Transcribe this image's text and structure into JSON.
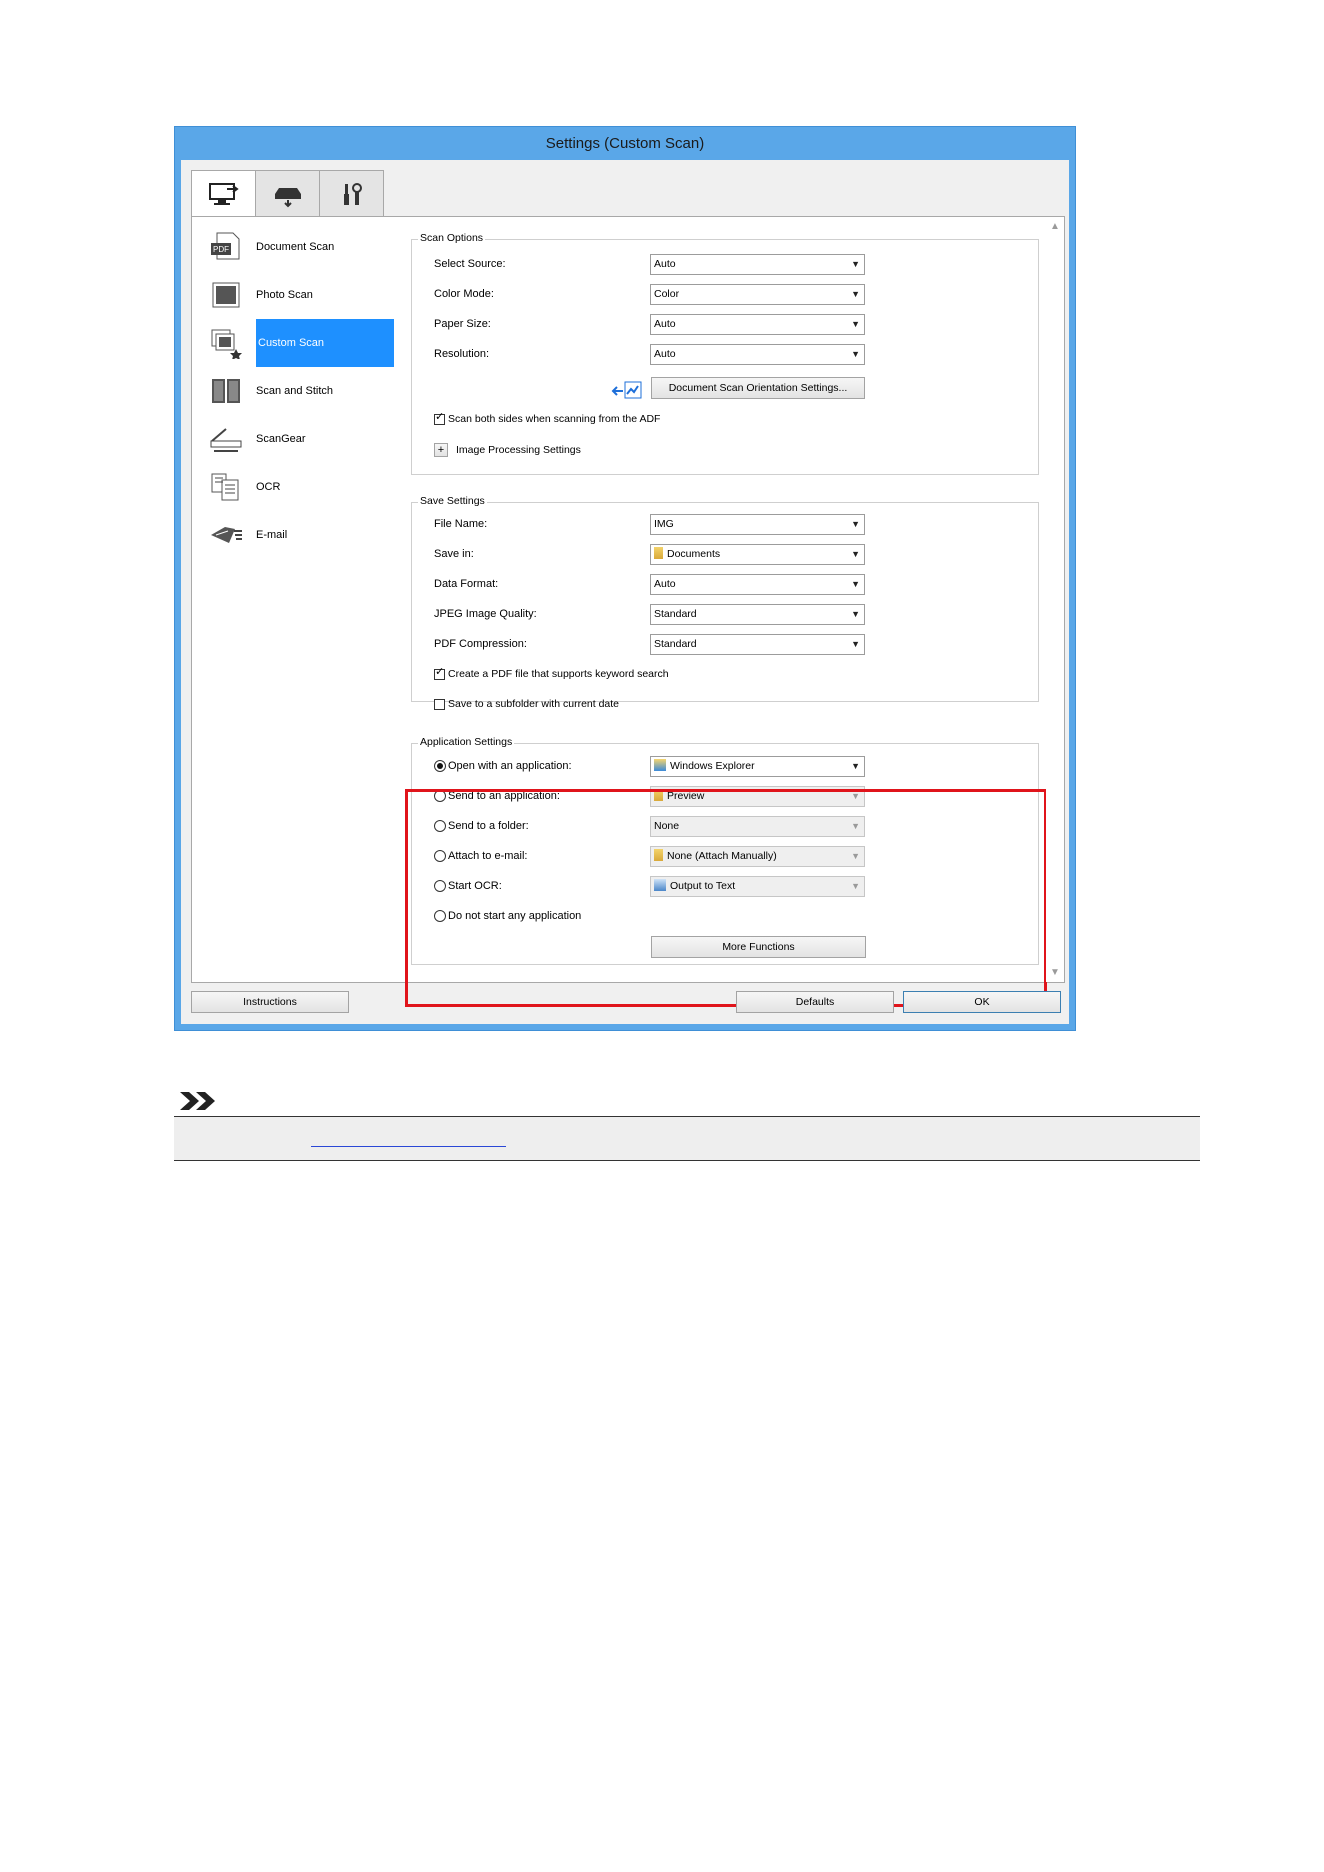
{
  "window": {
    "title": "Settings (Custom Scan)",
    "tabs": [
      {
        "icon": "computer-scan-icon"
      },
      {
        "icon": "scanner-icon"
      },
      {
        "icon": "general-settings-icon"
      }
    ]
  },
  "modes": [
    {
      "label": "Document Scan",
      "icon": "pdf-document-icon"
    },
    {
      "label": "Photo Scan",
      "icon": "photo-icon"
    },
    {
      "label": "Custom Scan",
      "icon": "custom-scan-icon",
      "selected": true
    },
    {
      "label": "Scan and Stitch",
      "icon": "stitch-icon"
    },
    {
      "label": "ScanGear",
      "icon": "scangear-icon"
    },
    {
      "label": "OCR",
      "icon": "ocr-icon"
    },
    {
      "label": "E-mail",
      "icon": "email-icon"
    }
  ],
  "scan_options": {
    "title": "Scan Options",
    "rows": [
      {
        "label": "Select Source:",
        "value": "Auto"
      },
      {
        "label": "Color Mode:",
        "value": "Color"
      },
      {
        "label": "Paper Size:",
        "value": "Auto"
      },
      {
        "label": "Resolution:",
        "value": "Auto"
      }
    ],
    "orientation_button": "Document Scan Orientation Settings...",
    "scan_both_sides": {
      "label": "Scan both sides when scanning from the ADF",
      "checked": true
    },
    "image_processing": {
      "expander": "+",
      "label": "Image Processing Settings"
    }
  },
  "save_settings": {
    "title": "Save Settings",
    "rows": [
      {
        "label": "File Name:",
        "value": "IMG"
      },
      {
        "label": "Save in:",
        "value": "Documents"
      },
      {
        "label": "Data Format:",
        "value": "Auto"
      },
      {
        "label": "JPEG Image Quality:",
        "value": "Standard"
      },
      {
        "label": "PDF Compression:",
        "value": "Standard"
      }
    ],
    "keyword_search": {
      "label": "Create a PDF file that supports keyword search",
      "checked": true
    },
    "subfolder": {
      "label": "Save to a subfolder with current date",
      "checked": false
    }
  },
  "application_settings": {
    "title": "Application Settings",
    "options": [
      {
        "label": "Open with an application:",
        "value": "Windows Explorer",
        "selected": true,
        "enabled": true
      },
      {
        "label": "Send to an application:",
        "value": "Preview",
        "selected": false,
        "enabled": false
      },
      {
        "label": "Send to a folder:",
        "value": "None",
        "selected": false,
        "enabled": false
      },
      {
        "label": "Attach to e-mail:",
        "value": "None (Attach Manually)",
        "selected": false,
        "enabled": false
      },
      {
        "label": "Start OCR:",
        "value": "Output to Text",
        "selected": false,
        "enabled": false
      },
      {
        "label": "Do not start any application",
        "selected": false
      }
    ],
    "more_functions": "More Functions",
    "highlight_color": "#e0141b"
  },
  "footer": {
    "instructions": "Instructions",
    "defaults": "Defaults",
    "ok": "OK"
  },
  "colors": {
    "title_bar": "#5aa7e8",
    "selected_mode": "#1e90ff"
  }
}
